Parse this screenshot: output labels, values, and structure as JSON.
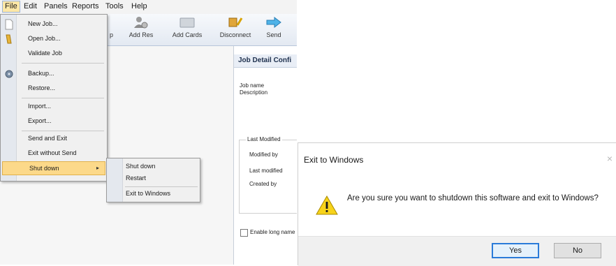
{
  "menubar": {
    "items": [
      {
        "label": "File"
      },
      {
        "label": "Edit"
      },
      {
        "label": "Panels"
      },
      {
        "label": "Reports"
      },
      {
        "label": "Tools"
      },
      {
        "label": "Help"
      }
    ]
  },
  "toolbar": {
    "buttons": [
      {
        "label": "p",
        "icon": "map-icon"
      },
      {
        "label": "Add Res",
        "icon": "add-resource-icon"
      },
      {
        "label": "Add Cards",
        "icon": "add-cards-icon"
      },
      {
        "label": "Disconnect",
        "icon": "disconnect-icon"
      },
      {
        "label": "Send",
        "icon": "send-arrow-icon"
      }
    ]
  },
  "file_menu": {
    "items": [
      {
        "label": "New Job...",
        "icon": "new-document-icon"
      },
      {
        "label": "Open Job...",
        "icon": "open-folder-icon"
      },
      {
        "label": "Validate Job"
      },
      {
        "label": "Backup...",
        "icon": "backup-disk-icon"
      },
      {
        "label": "Restore..."
      },
      {
        "label": "Import..."
      },
      {
        "label": "Export..."
      },
      {
        "label": "Send and Exit"
      },
      {
        "label": "Exit without Send"
      },
      {
        "label": "Shut down",
        "highlighted": true,
        "submenu_arrow": "▸"
      }
    ]
  },
  "shutdown_submenu": {
    "items": [
      {
        "label": "Shut down"
      },
      {
        "label": "Restart"
      },
      {
        "label": "Exit to Windows"
      }
    ]
  },
  "detail_panel": {
    "title": "Job Detail Confi",
    "job_name_label": "Job name",
    "description_label": "Description",
    "last_modified_group": "Last Modified",
    "modified_by_label": "Modified by",
    "last_modified_label": "Last modified",
    "created_by_label": "Created by",
    "enable_long_names_label": "Enable long name"
  },
  "dialog": {
    "title": "Exit to Windows",
    "close_glyph": "×",
    "message": "Are you sure you want to shutdown this software and exit to Windows?",
    "icon": "warning-icon",
    "yes_label": "Yes",
    "no_label": "No",
    "accent_color": "#2b7bd9",
    "warning_color": "#f7d31a"
  }
}
